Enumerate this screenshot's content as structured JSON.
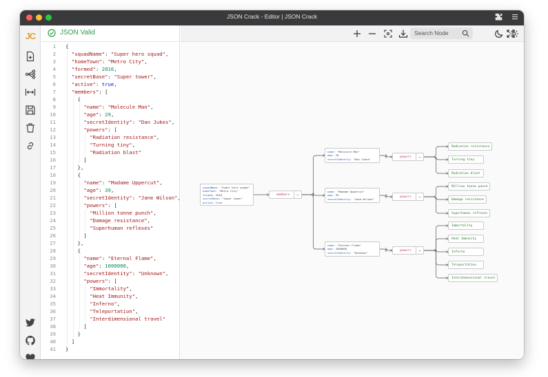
{
  "window": {
    "title": "JSON Crack - Editor | JSON Crack",
    "traffic_lights": [
      "#fe5f57",
      "#febc2e",
      "#28c840"
    ]
  },
  "sidebar": {
    "logo": "JC",
    "items": [
      {
        "icon": "new-file-icon"
      },
      {
        "icon": "graph-icon"
      },
      {
        "icon": "expand-horizontal-icon"
      },
      {
        "icon": "save-icon"
      },
      {
        "icon": "trash-icon"
      },
      {
        "icon": "link-icon"
      }
    ],
    "footer": [
      {
        "icon": "twitter-icon"
      },
      {
        "icon": "github-icon"
      },
      {
        "icon": "heart-icon"
      }
    ]
  },
  "editor": {
    "status": "JSON Valid",
    "status_color": "#2e9a47",
    "lines": [
      {
        "n": "1",
        "indent": 0,
        "html": "{"
      },
      {
        "n": "2",
        "indent": 1,
        "html": "<span class='k'>\"squadName\"</span>: <span class='s'>\"Super hero squad\"</span>,"
      },
      {
        "n": "3",
        "indent": 1,
        "html": "<span class='k'>\"homeTown\"</span>: <span class='s'>\"Metro City\"</span>,"
      },
      {
        "n": "4",
        "indent": 1,
        "html": "<span class='k'>\"formed\"</span>: <span class='n'>2016</span>,"
      },
      {
        "n": "5",
        "indent": 1,
        "html": "<span class='k'>\"secretBase\"</span>: <span class='s'>\"Super tower\"</span>,"
      },
      {
        "n": "6",
        "indent": 1,
        "html": "<span class='k'>\"active\"</span>: <span class='b'>true</span>,"
      },
      {
        "n": "7",
        "indent": 1,
        "html": "<span class='k'>\"members\"</span>: ["
      },
      {
        "n": "8",
        "indent": 2,
        "html": "{"
      },
      {
        "n": "9",
        "indent": 3,
        "html": "<span class='k'>\"name\"</span>: <span class='s'>\"Molecule Man\"</span>,"
      },
      {
        "n": "10",
        "indent": 3,
        "html": "<span class='k'>\"age\"</span>: <span class='n'>29</span>,"
      },
      {
        "n": "11",
        "indent": 3,
        "html": "<span class='k'>\"secretIdentity\"</span>: <span class='s'>\"Dan Jukes\"</span>,"
      },
      {
        "n": "12",
        "indent": 3,
        "html": "<span class='k'>\"powers\"</span>: ["
      },
      {
        "n": "13",
        "indent": 4,
        "html": "<span class='s'>\"Radiation resistance\"</span>,"
      },
      {
        "n": "14",
        "indent": 4,
        "html": "<span class='s'>\"Turning tiny\"</span>,"
      },
      {
        "n": "15",
        "indent": 4,
        "html": "<span class='s'>\"Radiation blast\"</span>"
      },
      {
        "n": "16",
        "indent": 3,
        "html": "]"
      },
      {
        "n": "17",
        "indent": 2,
        "html": "},"
      },
      {
        "n": "18",
        "indent": 2,
        "html": "{"
      },
      {
        "n": "19",
        "indent": 3,
        "html": "<span class='k'>\"name\"</span>: <span class='s'>\"Madame Uppercut\"</span>,"
      },
      {
        "n": "20",
        "indent": 3,
        "html": "<span class='k'>\"age\"</span>: <span class='n'>39</span>,"
      },
      {
        "n": "21",
        "indent": 3,
        "html": "<span class='k'>\"secretIdentity\"</span>: <span class='s'>\"Jane Wilson\"</span>,"
      },
      {
        "n": "22",
        "indent": 3,
        "html": "<span class='k'>\"powers\"</span>: ["
      },
      {
        "n": "23",
        "indent": 4,
        "html": "<span class='s'>\"Million tonne punch\"</span>,"
      },
      {
        "n": "24",
        "indent": 4,
        "html": "<span class='s'>\"Damage resistance\"</span>,"
      },
      {
        "n": "25",
        "indent": 4,
        "html": "<span class='s'>\"Superhuman reflexes\"</span>"
      },
      {
        "n": "26",
        "indent": 3,
        "html": "]"
      },
      {
        "n": "27",
        "indent": 2,
        "html": "},"
      },
      {
        "n": "28",
        "indent": 2,
        "html": "{"
      },
      {
        "n": "29",
        "indent": 3,
        "html": "<span class='k'>\"name\"</span>: <span class='s'>\"Eternal Flame\"</span>,"
      },
      {
        "n": "30",
        "indent": 3,
        "html": "<span class='k'>\"age\"</span>: <span class='n'>1000000</span>,"
      },
      {
        "n": "31",
        "indent": 3,
        "html": "<span class='k'>\"secretIdentity\"</span>: <span class='s'>\"Unknown\"</span>,"
      },
      {
        "n": "32",
        "indent": 3,
        "html": "<span class='k'>\"powers\"</span>: ["
      },
      {
        "n": "33",
        "indent": 4,
        "html": "<span class='s'>\"Immortality\"</span>,"
      },
      {
        "n": "34",
        "indent": 4,
        "html": "<span class='s'>\"Heat Immunity\"</span>,"
      },
      {
        "n": "35",
        "indent": 4,
        "html": "<span class='s'>\"Inferno\"</span>,"
      },
      {
        "n": "36",
        "indent": 4,
        "html": "<span class='s'>\"Teleportation\"</span>,"
      },
      {
        "n": "37",
        "indent": 4,
        "html": "<span class='s'>\"Interdimensional travel\"</span>"
      },
      {
        "n": "38",
        "indent": 3,
        "html": "]"
      },
      {
        "n": "39",
        "indent": 2,
        "html": "}"
      },
      {
        "n": "40",
        "indent": 1,
        "html": "]"
      },
      {
        "n": "41",
        "indent": 0,
        "html": "}"
      }
    ]
  },
  "toolbar": {
    "search_placeholder": "Search Node",
    "tools": [
      "zoom-in-icon",
      "zoom-out-icon",
      "focus-icon",
      "download-icon",
      "search-icon",
      "moon-icon",
      "settings-icon",
      "fullscreen-icon"
    ]
  },
  "graph": {
    "root": [
      [
        "squadName",
        "\"Super hero squad\""
      ],
      [
        "homeTown",
        "\"Metro City\""
      ],
      [
        "formed",
        "2016"
      ],
      [
        "secretBase",
        "\"Super tower\""
      ],
      [
        "active",
        "true"
      ]
    ],
    "members_label": "members",
    "members": [
      {
        "fields": [
          [
            "name",
            "\"Molecule Man\""
          ],
          [
            "age",
            "29"
          ],
          [
            "secretIdentity",
            "\"Dan Jukes\""
          ]
        ],
        "powers_label": "powers",
        "powers": [
          "Radiation resistance",
          "Turning tiny",
          "Radiation blast"
        ]
      },
      {
        "fields": [
          [
            "name",
            "\"Madame Uppercut\""
          ],
          [
            "age",
            "39"
          ],
          [
            "secretIdentity",
            "\"Jane Wilson\""
          ]
        ],
        "powers_label": "powers",
        "powers": [
          "Million tonne punch",
          "Damage resistance",
          "Superhuman reflexes"
        ]
      },
      {
        "fields": [
          [
            "name",
            "\"Eternal Flame\""
          ],
          [
            "age",
            "1000000"
          ],
          [
            "secretIdentity",
            "\"Unknown\""
          ]
        ],
        "powers_label": "powers",
        "powers": [
          "Immortality",
          "Heat Immunity",
          "Inferno",
          "Teleportation",
          "Interdimensional travel"
        ]
      }
    ]
  }
}
